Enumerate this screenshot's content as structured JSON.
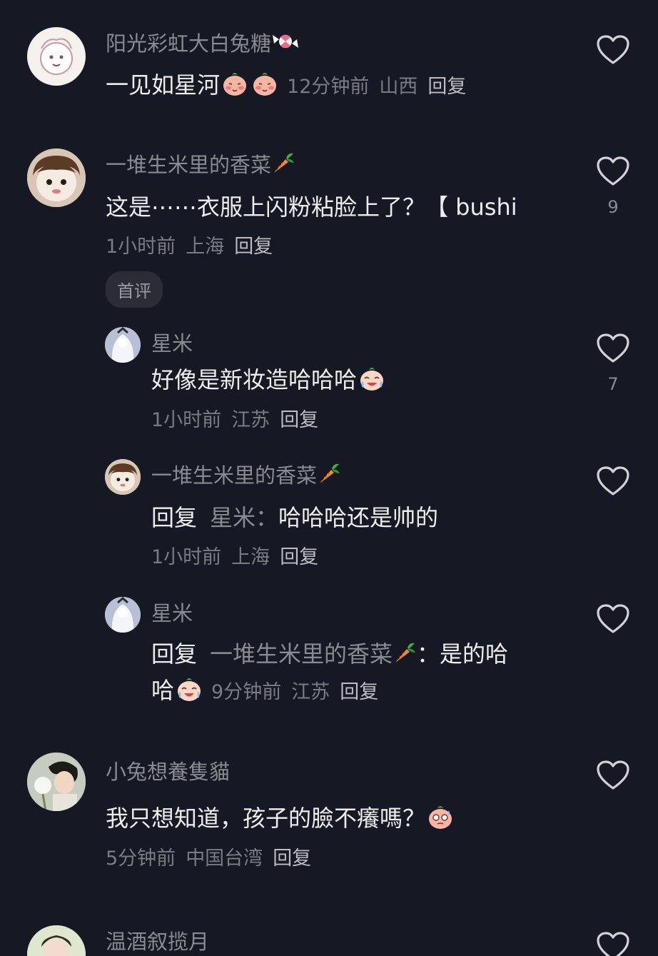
{
  "comments": [
    {
      "name": "阳光彩虹大白兔糖",
      "name_emoji": "candy-icon",
      "text": "一见如星河",
      "text_emojis": [
        "shy-face-emoji",
        "shy-face-emoji"
      ],
      "time": "12分钟前",
      "location": "山西",
      "reply": "回复",
      "likes": ""
    },
    {
      "name": "一堆生米里的香菜",
      "name_emoji": "carrot-icon",
      "text": "这是⋯⋯衣服上闪粉粘脸上了？【 bushi",
      "time": "1小时前",
      "location": "上海",
      "reply": "回复",
      "likes": "9",
      "badge": "首评",
      "replies": [
        {
          "name": "星米",
          "text": "好像是新妆造哈哈哈",
          "text_emoji": "laugh-cry-emoji",
          "time": "1小时前",
          "location": "江苏",
          "reply": "回复",
          "likes": "7"
        },
        {
          "name": "一堆生米里的香菜",
          "name_emoji": "carrot-icon",
          "reply_prefix": "回复",
          "reply_target": "星米：",
          "text": "哈哈哈还是帅的",
          "time": "1小时前",
          "location": "上海",
          "reply": "回复",
          "likes": ""
        },
        {
          "name": "星米",
          "reply_prefix": "回复",
          "reply_target": "一堆生米里的香菜",
          "reply_target_emoji": "carrot-icon",
          "text_line1": "：是的哈",
          "text_line2": "哈",
          "text_emoji": "laugh-cry-emoji",
          "time": "9分钟前",
          "location": "江苏",
          "reply": "回复",
          "likes": ""
        }
      ]
    },
    {
      "name": "小兔想養隻貓",
      "text": "我只想知道，孩子的臉不癢嗎？",
      "text_emoji": "nervous-face-emoji",
      "time": "5分钟前",
      "location": "中国台湾",
      "reply": "回复",
      "likes": ""
    },
    {
      "name": "温酒叙揽月",
      "likes": ""
    }
  ],
  "colors": {
    "background": "#161823",
    "name": "#8a8b91",
    "text": "#ededee",
    "meta": "#7b7c82"
  }
}
